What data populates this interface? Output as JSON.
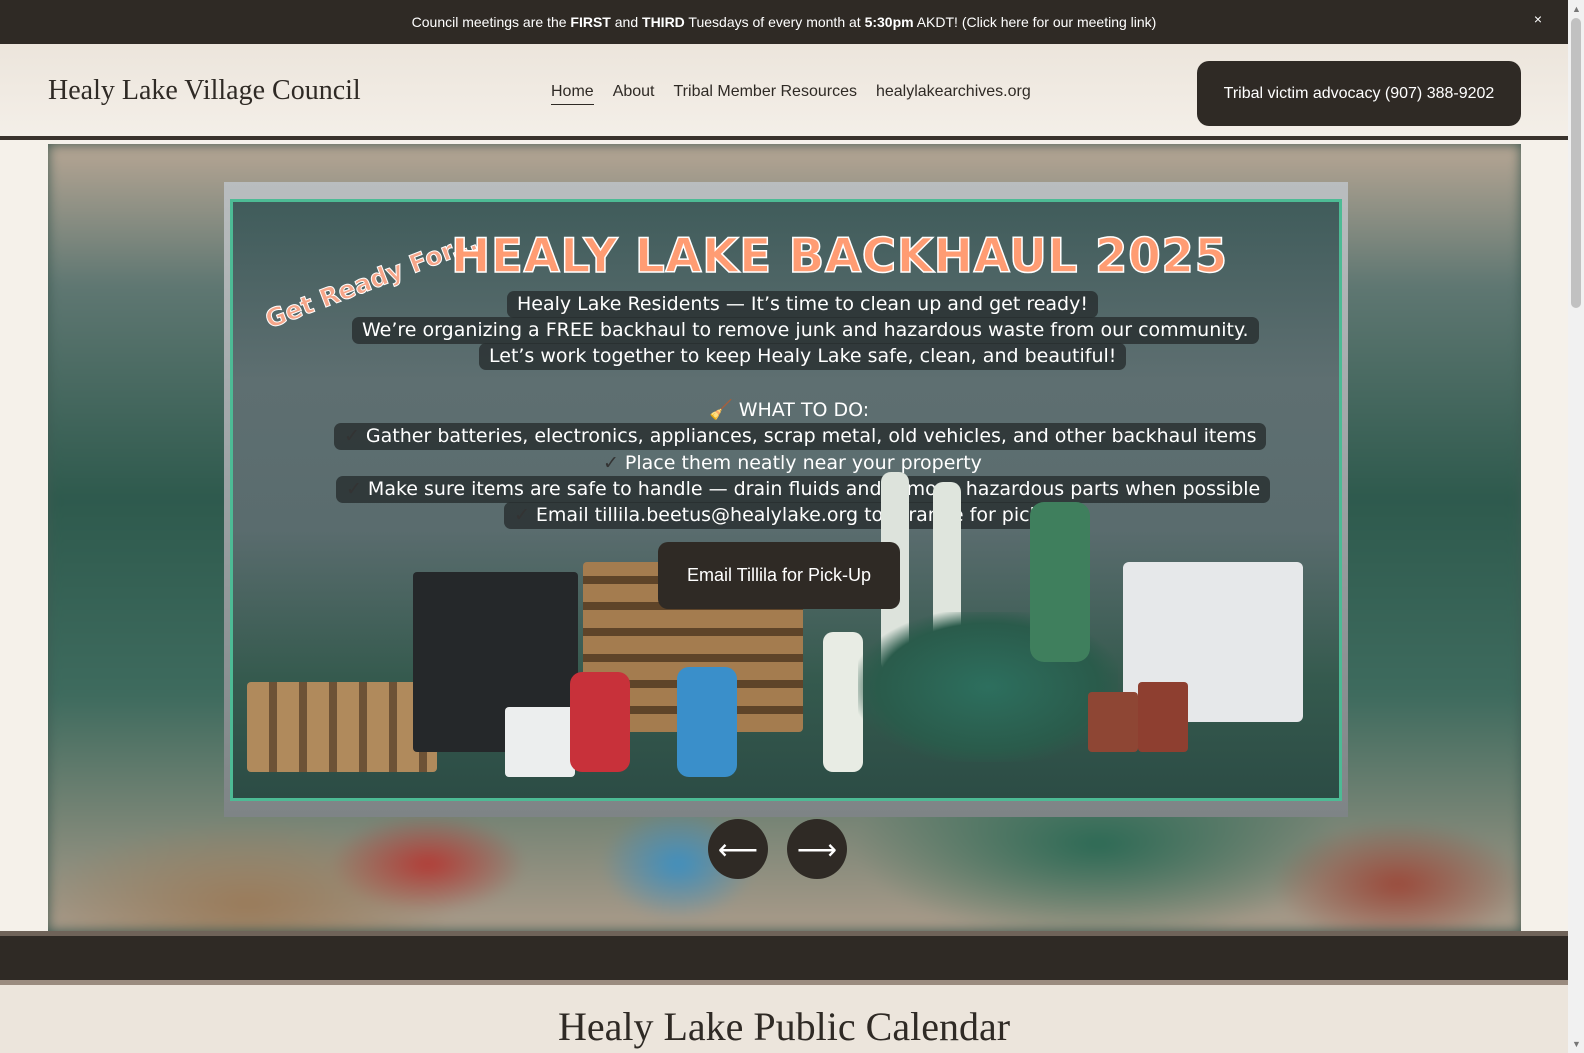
{
  "announcement": {
    "part1": "Council meetings are the ",
    "first": "FIRST",
    "part2": " and ",
    "third": "THIRD",
    "part3": " Tuesdays of every month at ",
    "time": "5:30pm",
    "part4": " AKDT! (Click here for our meeting link)",
    "close": "×"
  },
  "header": {
    "site_title": "Healy Lake Village Council",
    "nav": [
      "Home",
      "About",
      "Tribal Member Resources",
      "healylakearchives.org"
    ],
    "cta": "Tribal victim advocacy (907) 388-9202"
  },
  "banner": {
    "tagline": "Get Ready For...",
    "headline": "HEALY LAKE BACKHAUL 2025",
    "intro": [
      "Healy Lake Residents — It’s time to clean up and get ready!",
      "We’re organizing a FREE backhaul to remove junk and hazardous waste from our community.",
      "Let’s work together to keep Healy Lake safe, clean, and beautiful!"
    ],
    "todo_heading": "🧹 WHAT TO DO:",
    "checkmark": "✓",
    "todo_items": [
      "Gather batteries, electronics, appliances, scrap metal, old vehicles, and other backhaul items",
      "Place them neatly near your property",
      "Make sure items are safe to handle — drain fluids and remove hazardous parts when possible",
      "Email tillila.beetus@healylake.org to arrange for pick-up"
    ]
  },
  "hero": {
    "email_button": "Email Tillila for Pick-Up",
    "prev_arrow": "⟵",
    "next_arrow": "⟶"
  },
  "calendar": {
    "title": "Healy Lake Public Calendar"
  },
  "scrollbar": {
    "up": "▲",
    "down": "▼"
  }
}
